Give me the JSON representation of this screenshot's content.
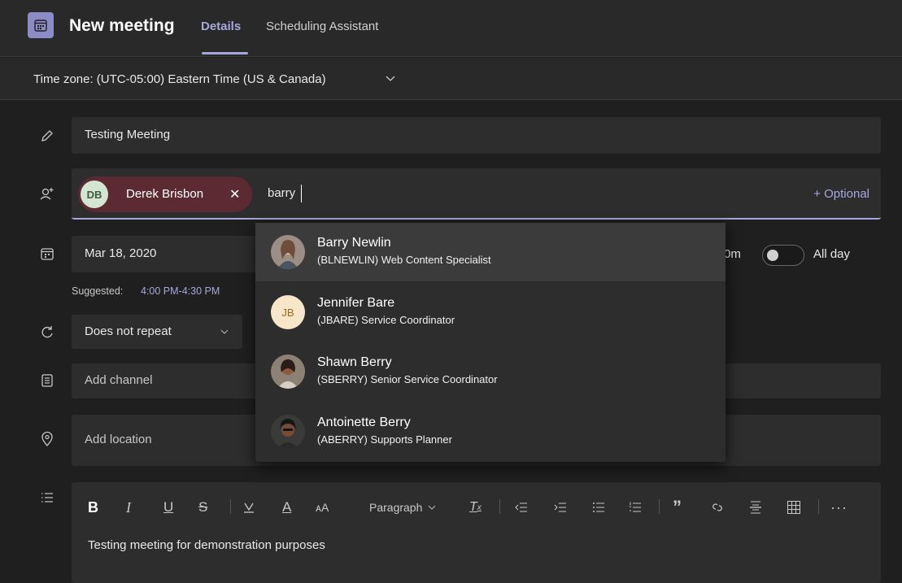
{
  "header": {
    "title": "New meeting",
    "tabs": [
      {
        "label": "Details",
        "active": true
      },
      {
        "label": "Scheduling Assistant",
        "active": false
      }
    ],
    "accent": "#a6a7dc"
  },
  "timezone": {
    "label": "Time zone: (UTC-05:00) Eastern Time (US & Canada)"
  },
  "form": {
    "title_value": "Testing Meeting",
    "attendee_chip": {
      "initials": "DB",
      "name": "Derek Brisbon"
    },
    "attendee_query": "barry",
    "optional_label": "+ Optional",
    "date": "Mar 18, 2020",
    "time_partial": "0m",
    "all_day_label": "All day",
    "suggested_label": "Suggested:",
    "suggested_time": "4:00 PM-4:30 PM",
    "repeat_value": "Does not repeat",
    "channel_placeholder": "Add channel",
    "location_placeholder": "Add location",
    "editor": {
      "paragraph_label": "Paragraph",
      "body": "Testing meeting for demonstration purposes"
    }
  },
  "suggestions": [
    {
      "name": "Barry Newlin",
      "detail": "(BLNEWLIN) Web Content Specialist",
      "avatar": "photo",
      "avatar_color": "#8a7a70"
    },
    {
      "name": "Jennifer Bare",
      "detail": "(JBARE) Service Coordinator",
      "avatar": "initials",
      "initials": "JB",
      "avatar_color": "#f7e6c9"
    },
    {
      "name": "Shawn Berry",
      "detail": "(SBERRY) Senior Service Coordinator",
      "avatar": "photo",
      "avatar_color": "#6e5d52"
    },
    {
      "name": "Antoinette Berry",
      "detail": "(ABERRY) Supports Planner",
      "avatar": "photo",
      "avatar_color": "#4b3a33"
    }
  ]
}
